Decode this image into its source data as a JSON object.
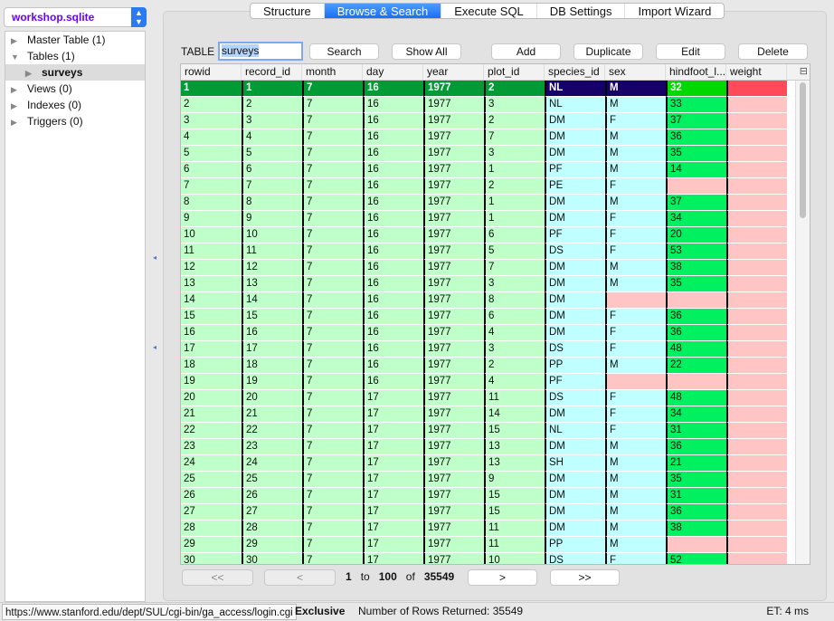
{
  "sidebar": {
    "database": "workshop.sqlite",
    "items": [
      {
        "label": "Master Table (1)",
        "expanded": false
      },
      {
        "label": "Tables (1)",
        "expanded": true
      },
      {
        "label": "surveys",
        "selected": true
      },
      {
        "label": "Views (0)",
        "expanded": false
      },
      {
        "label": "Indexes (0)",
        "expanded": false
      },
      {
        "label": "Triggers (0)",
        "expanded": false
      }
    ]
  },
  "tabs": [
    {
      "label": "Structure"
    },
    {
      "label": "Browse & Search",
      "active": true
    },
    {
      "label": "Execute SQL"
    },
    {
      "label": "DB Settings"
    },
    {
      "label": "Import Wizard"
    }
  ],
  "toolbar": {
    "table_label": "TABLE",
    "table_value": "surveys",
    "search": "Search",
    "show_all": "Show All",
    "add": "Add",
    "duplicate": "Duplicate",
    "edit": "Edit",
    "delete": "Delete"
  },
  "columns": [
    "rowid",
    "record_id",
    "month",
    "day",
    "year",
    "plot_id",
    "species_id",
    "sex",
    "hindfoot_l...",
    "weight"
  ],
  "colors": {
    "int": "#bfffc9",
    "int_sel": "#009b35",
    "text": "#c0ffff",
    "text_sel": "#160068",
    "real": "#00f060",
    "real_sel": "#00d800",
    "null": "#ffc4c4",
    "null_sel": "#ff4a5a"
  },
  "rows": [
    [
      1,
      1,
      7,
      16,
      1977,
      2,
      "NL",
      "M",
      32,
      null
    ],
    [
      2,
      2,
      7,
      16,
      1977,
      3,
      "NL",
      "M",
      33,
      null
    ],
    [
      3,
      3,
      7,
      16,
      1977,
      2,
      "DM",
      "F",
      37,
      null
    ],
    [
      4,
      4,
      7,
      16,
      1977,
      7,
      "DM",
      "M",
      36,
      null
    ],
    [
      5,
      5,
      7,
      16,
      1977,
      3,
      "DM",
      "M",
      35,
      null
    ],
    [
      6,
      6,
      7,
      16,
      1977,
      1,
      "PF",
      "M",
      14,
      null
    ],
    [
      7,
      7,
      7,
      16,
      1977,
      2,
      "PE",
      "F",
      null,
      null
    ],
    [
      8,
      8,
      7,
      16,
      1977,
      1,
      "DM",
      "M",
      37,
      null
    ],
    [
      9,
      9,
      7,
      16,
      1977,
      1,
      "DM",
      "F",
      34,
      null
    ],
    [
      10,
      10,
      7,
      16,
      1977,
      6,
      "PF",
      "F",
      20,
      null
    ],
    [
      11,
      11,
      7,
      16,
      1977,
      5,
      "DS",
      "F",
      53,
      null
    ],
    [
      12,
      12,
      7,
      16,
      1977,
      7,
      "DM",
      "M",
      38,
      null
    ],
    [
      13,
      13,
      7,
      16,
      1977,
      3,
      "DM",
      "M",
      35,
      null
    ],
    [
      14,
      14,
      7,
      16,
      1977,
      8,
      "DM",
      null,
      null,
      null
    ],
    [
      15,
      15,
      7,
      16,
      1977,
      6,
      "DM",
      "F",
      36,
      null
    ],
    [
      16,
      16,
      7,
      16,
      1977,
      4,
      "DM",
      "F",
      36,
      null
    ],
    [
      17,
      17,
      7,
      16,
      1977,
      3,
      "DS",
      "F",
      48,
      null
    ],
    [
      18,
      18,
      7,
      16,
      1977,
      2,
      "PP",
      "M",
      22,
      null
    ],
    [
      19,
      19,
      7,
      16,
      1977,
      4,
      "PF",
      null,
      null,
      null
    ],
    [
      20,
      20,
      7,
      17,
      1977,
      11,
      "DS",
      "F",
      48,
      null
    ],
    [
      21,
      21,
      7,
      17,
      1977,
      14,
      "DM",
      "F",
      34,
      null
    ],
    [
      22,
      22,
      7,
      17,
      1977,
      15,
      "NL",
      "F",
      31,
      null
    ],
    [
      23,
      23,
      7,
      17,
      1977,
      13,
      "DM",
      "M",
      36,
      null
    ],
    [
      24,
      24,
      7,
      17,
      1977,
      13,
      "SH",
      "M",
      21,
      null
    ],
    [
      25,
      25,
      7,
      17,
      1977,
      9,
      "DM",
      "M",
      35,
      null
    ],
    [
      26,
      26,
      7,
      17,
      1977,
      15,
      "DM",
      "M",
      31,
      null
    ],
    [
      27,
      27,
      7,
      17,
      1977,
      15,
      "DM",
      "M",
      36,
      null
    ],
    [
      28,
      28,
      7,
      17,
      1977,
      11,
      "DM",
      "M",
      38,
      null
    ],
    [
      29,
      29,
      7,
      17,
      1977,
      11,
      "PP",
      "M",
      null,
      null
    ],
    [
      30,
      30,
      7,
      17,
      1977,
      10,
      "DS",
      "F",
      52,
      null
    ]
  ],
  "pager": {
    "first": "<<",
    "prev": "<",
    "from": "1",
    "to_label": "to",
    "to": "100",
    "of_label": "of",
    "total": "35549",
    "next": ">",
    "last": ">>"
  },
  "status": {
    "url": "https://www.stanford.edu/dept/SUL/cgi-bin/ga_access/login.cgi",
    "mode": "Exclusive",
    "rows_returned": "Number of Rows Returned: 35549",
    "elapsed": "ET: 4 ms"
  }
}
